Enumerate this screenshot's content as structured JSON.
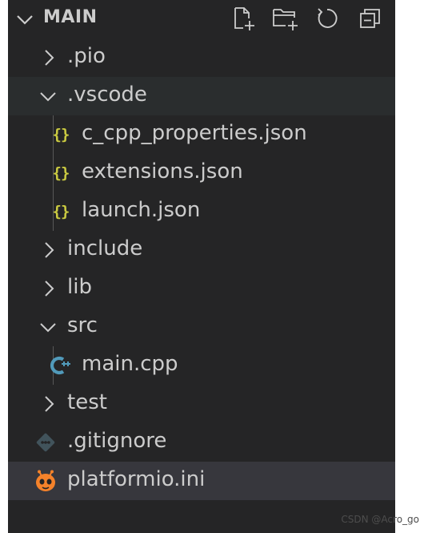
{
  "explorer": {
    "title": "MAIN",
    "actions": [
      {
        "name": "new-file-icon"
      },
      {
        "name": "new-folder-icon"
      },
      {
        "name": "refresh-icon"
      },
      {
        "name": "collapse-all-icon"
      }
    ],
    "items": [
      {
        "label": ".pio",
        "type": "folder",
        "expanded": false
      },
      {
        "label": ".vscode",
        "type": "folder",
        "expanded": true
      },
      {
        "label": "c_cpp_properties.json",
        "type": "file",
        "icon": "json-braces-icon"
      },
      {
        "label": "extensions.json",
        "type": "file",
        "icon": "json-braces-icon"
      },
      {
        "label": "launch.json",
        "type": "file",
        "icon": "json-braces-icon"
      },
      {
        "label": "include",
        "type": "folder",
        "expanded": false
      },
      {
        "label": "lib",
        "type": "folder",
        "expanded": false
      },
      {
        "label": "src",
        "type": "folder",
        "expanded": true
      },
      {
        "label": "main.cpp",
        "type": "file",
        "icon": "cpp-icon"
      },
      {
        "label": "test",
        "type": "folder",
        "expanded": false
      },
      {
        "label": ".gitignore",
        "type": "file",
        "icon": "git-icon"
      },
      {
        "label": "platformio.ini",
        "type": "file",
        "icon": "platformio-icon"
      }
    ]
  },
  "colors": {
    "panel_background": "#252526",
    "hover_background": "#2a2d2e",
    "selected_background": "#37373d",
    "text": "#cccccc",
    "json_icon": "#cbcb41",
    "cpp_icon": "#519aba",
    "git_icon": "#41535b",
    "platformio_icon": "#f5822a"
  },
  "watermark": "CSDN @Acro_go"
}
